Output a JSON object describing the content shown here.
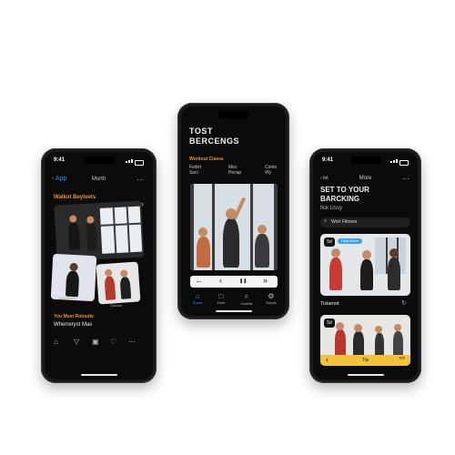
{
  "phones": {
    "left": {
      "time": "9:41",
      "nav": {
        "back_label": "App",
        "title": "Morth",
        "more": "…",
        "chevron": "›"
      },
      "section1": "Walkut Beyluets",
      "caption1": "Rect Beets",
      "caption2": "Classibe",
      "section2": "You Most Rotoutte",
      "subtitle": "Wherreryst Mas",
      "tabs": [
        "⌂",
        "▽",
        "▣",
        "♡",
        "⋯"
      ]
    },
    "center": {
      "title_line1": "TOST",
      "title_line2": "BERCENGS",
      "section": "Workout Classe",
      "cols": [
        {
          "line1": "Fetbrt",
          "line2": "Seci"
        },
        {
          "line1": "Mex",
          "line2": "Pecap"
        },
        {
          "line1": "Conto",
          "line2": "Wy"
        }
      ],
      "controls": [
        "←",
        "‹",
        "❚❚",
        "»"
      ],
      "tabs": [
        {
          "icon": "⌂",
          "label": "Share"
        },
        {
          "icon": "□",
          "label": "Hore"
        },
        {
          "icon": "⌕",
          "label": "Ourtrlis"
        },
        {
          "icon": "⚙",
          "label": "Sorple"
        }
      ]
    },
    "right": {
      "time": "9:41",
      "nav": {
        "back_label": "‹ Int",
        "title": "More",
        "more": "…"
      },
      "title_line1": "SET TO YOUR",
      "title_line2": "BARCKING",
      "subtitle": "fick Ussy",
      "search_text": "Wort Fitnees",
      "badge1": "5d",
      "pill": "Fiwtn fionee",
      "card_label": "Tislamot",
      "badge2": "5d",
      "bottom_bar": {
        "left": "‹",
        "middle": "Tliv",
        "right": "»»"
      },
      "accent": "#f2c23a"
    }
  }
}
